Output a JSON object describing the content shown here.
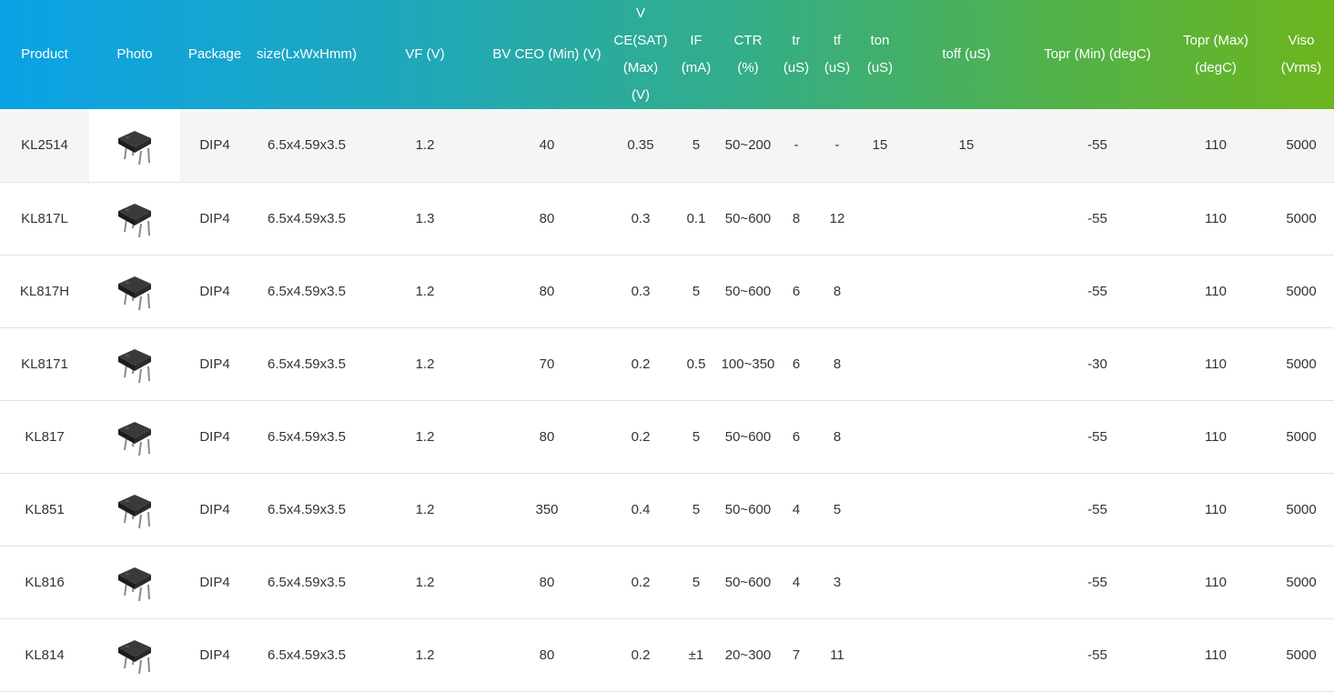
{
  "table": {
    "headers": [
      {
        "lines": [
          "Product"
        ]
      },
      {
        "lines": [
          "Photo"
        ]
      },
      {
        "lines": [
          "Package"
        ]
      },
      {
        "lines": [
          "size(LxWxHmm)"
        ]
      },
      {
        "lines": [
          "VF (V)"
        ]
      },
      {
        "lines": [
          "BV CEO (Min) (V)"
        ]
      },
      {
        "lines": [
          "V",
          "CE(SAT)",
          "(Max)",
          "(V)"
        ]
      },
      {
        "lines": [
          "IF",
          "(mA)"
        ]
      },
      {
        "lines": [
          "CTR",
          "(%)"
        ]
      },
      {
        "lines": [
          "tr",
          "(uS)"
        ]
      },
      {
        "lines": [
          "tf",
          "(uS)"
        ]
      },
      {
        "lines": [
          "ton",
          "(uS)"
        ]
      },
      {
        "lines": [
          "toff (uS)"
        ]
      },
      {
        "lines": [
          "Topr (Min) (degC)"
        ]
      },
      {
        "lines": [
          "Topr (Max)",
          "(degC)"
        ]
      },
      {
        "lines": [
          "Viso",
          "(Vrms)"
        ]
      }
    ],
    "rows": [
      {
        "product": "KL2514",
        "photo_icon": "dip4-chip-icon",
        "package": "DIP4",
        "size": "6.5x4.59x3.5",
        "vf": "1.2",
        "bv_ceo": "40",
        "vce_sat": "0.35",
        "if_ma": "5",
        "ctr": "50~200",
        "tr": "-",
        "tf": "-",
        "ton": "15",
        "toff": "15",
        "topr_min": "-55",
        "topr_max": "110",
        "viso": "5000"
      },
      {
        "product": "KL817L",
        "photo_icon": "dip4-chip-icon",
        "package": "DIP4",
        "size": "6.5x4.59x3.5",
        "vf": "1.3",
        "bv_ceo": "80",
        "vce_sat": "0.3",
        "if_ma": "0.1",
        "ctr": "50~600",
        "tr": "8",
        "tf": "12",
        "ton": "",
        "toff": "",
        "topr_min": "-55",
        "topr_max": "110",
        "viso": "5000"
      },
      {
        "product": "KL817H",
        "photo_icon": "dip4-chip-icon",
        "package": "DIP4",
        "size": "6.5x4.59x3.5",
        "vf": "1.2",
        "bv_ceo": "80",
        "vce_sat": "0.3",
        "if_ma": "5",
        "ctr": "50~600",
        "tr": "6",
        "tf": "8",
        "ton": "",
        "toff": "",
        "topr_min": "-55",
        "topr_max": "110",
        "viso": "5000"
      },
      {
        "product": "KL8171",
        "photo_icon": "dip4-chip-icon",
        "package": "DIP4",
        "size": "6.5x4.59x3.5",
        "vf": "1.2",
        "bv_ceo": "70",
        "vce_sat": "0.2",
        "if_ma": "0.5",
        "ctr": "100~350",
        "tr": "6",
        "tf": "8",
        "ton": "",
        "toff": "",
        "topr_min": "-30",
        "topr_max": "110",
        "viso": "5000"
      },
      {
        "product": "KL817",
        "photo_icon": "dip4-chip-icon",
        "package": "DIP4",
        "size": "6.5x4.59x3.5",
        "vf": "1.2",
        "bv_ceo": "80",
        "vce_sat": "0.2",
        "if_ma": "5",
        "ctr": "50~600",
        "tr": "6",
        "tf": "8",
        "ton": "",
        "toff": "",
        "topr_min": "-55",
        "topr_max": "110",
        "viso": "5000"
      },
      {
        "product": "KL851",
        "photo_icon": "dip4-chip-icon",
        "package": "DIP4",
        "size": "6.5x4.59x3.5",
        "vf": "1.2",
        "bv_ceo": "350",
        "vce_sat": "0.4",
        "if_ma": "5",
        "ctr": "50~600",
        "tr": "4",
        "tf": "5",
        "ton": "",
        "toff": "",
        "topr_min": "-55",
        "topr_max": "110",
        "viso": "5000"
      },
      {
        "product": "KL816",
        "photo_icon": "dip4-chip-icon",
        "package": "DIP4",
        "size": "6.5x4.59x3.5",
        "vf": "1.2",
        "bv_ceo": "80",
        "vce_sat": "0.2",
        "if_ma": "5",
        "ctr": "50~600",
        "tr": "4",
        "tf": "3",
        "ton": "",
        "toff": "",
        "topr_min": "-55",
        "topr_max": "110",
        "viso": "5000"
      },
      {
        "product": "KL814",
        "photo_icon": "dip4-chip-icon",
        "package": "DIP4",
        "size": "6.5x4.59x3.5",
        "vf": "1.2",
        "bv_ceo": "80",
        "vce_sat": "0.2",
        "if_ma": "±1",
        "ctr": "20~300",
        "tr": "7",
        "tf": "11",
        "ton": "",
        "toff": "",
        "topr_min": "-55",
        "topr_max": "110",
        "viso": "5000"
      }
    ]
  }
}
